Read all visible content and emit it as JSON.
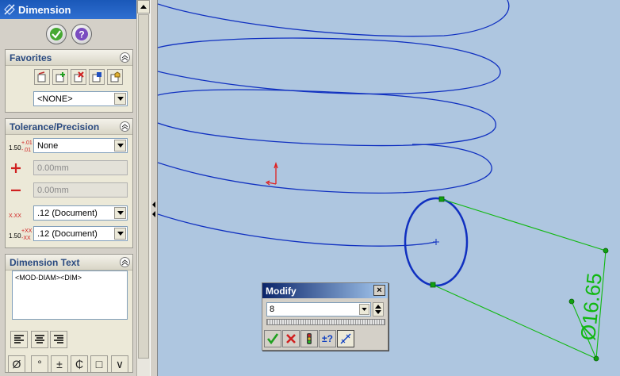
{
  "panel": {
    "title": "Dimension",
    "title_icon": "dimension-icon",
    "ok_icon": "checkmark-icon",
    "help_icon": "question-icon",
    "favorites": {
      "title": "Favorites",
      "buttons": [
        "apply-favorite-icon",
        "add-favorite-icon",
        "delete-favorite-icon",
        "save-favorite-icon",
        "load-favorite-icon"
      ],
      "selected": "<NONE>"
    },
    "tolerance": {
      "title": "Tolerance/Precision",
      "tolerance_type": "None",
      "tolerance_icon_main": "1.50",
      "tolerance_icon_upper": "+.01",
      "tolerance_icon_lower": "-.01",
      "plus_value": "0.00mm",
      "minus_value": "0.00mm",
      "precision_icon": "X.XX",
      "primary_precision": ".12 (Document)",
      "tolerance_precision_icon_main": "1.50",
      "tolerance_precision_icon_upper": "+XX",
      "tolerance_precision_icon_lower": "-XX",
      "tolerance_precision": ".12 (Document)"
    },
    "dimension_text": {
      "title": "Dimension Text",
      "value": "<MOD-DIAM><DIM>",
      "symbols": [
        "Ø",
        "°",
        "±",
        "₵",
        "□",
        "∨"
      ]
    }
  },
  "modify": {
    "title": "Modify",
    "close": "×",
    "value": "8",
    "buttons": [
      "ok-icon",
      "cancel-icon",
      "rebuild-icon",
      "reset-icon",
      "mark-dimension-icon"
    ],
    "reset_label": "±?"
  },
  "drawing": {
    "dimension_value": "Ø16.65",
    "colors": {
      "background": "#aec6e0",
      "curve": "#1030c0",
      "dimension": "#10b810",
      "handle": "#10a010",
      "axis": "#e02020"
    }
  }
}
